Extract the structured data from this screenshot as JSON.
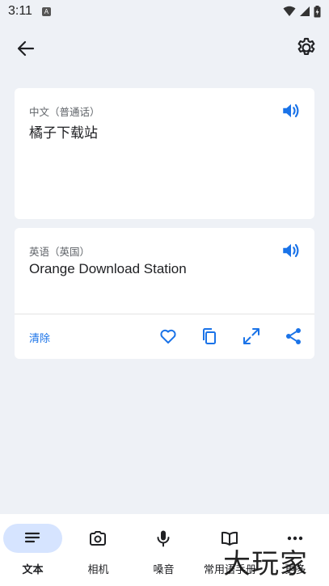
{
  "status_bar": {
    "time": "3:11",
    "badge": "A"
  },
  "source": {
    "language": "中文（普通话）",
    "text": "橘子下载站"
  },
  "target": {
    "language": "英语（英国）",
    "text": "Orange Download Station"
  },
  "actions": {
    "clear_label": "清除"
  },
  "nav": {
    "items": [
      {
        "label": "文本",
        "icon": "text-lines-icon"
      },
      {
        "label": "相机",
        "icon": "camera-icon"
      },
      {
        "label": "嗓音",
        "icon": "microphone-icon"
      },
      {
        "label": "常用语手册",
        "icon": "book-icon"
      },
      {
        "label": "更多",
        "icon": "more-icon"
      }
    ],
    "active_index": 0
  },
  "watermark": "大玩家",
  "colors": {
    "accent": "#1a73e8",
    "active_pill": "#d6e4ff",
    "background": "#eef1f6"
  }
}
